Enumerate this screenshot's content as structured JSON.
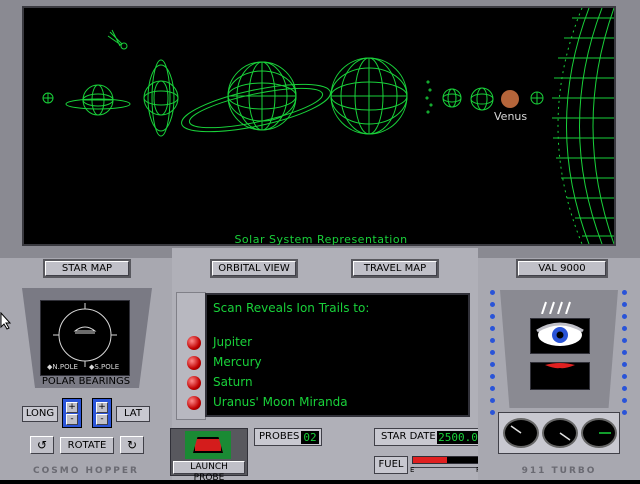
{
  "viewport": {
    "caption": "Solar System Representation",
    "venus_label": "Venus"
  },
  "nav": {
    "star_map": "STAR MAP",
    "orbital_view": "ORBITAL VIEW",
    "travel_map": "TRAVEL MAP",
    "val_9000": "VAL 9000"
  },
  "left_panel": {
    "polar_bearings": "POLAR BEARINGS",
    "n_pole": "N.POLE",
    "s_pole": "S.POLE",
    "long": "LONG",
    "lat": "LAT",
    "rotate": "ROTATE",
    "plus": "+",
    "minus": "-",
    "brand": "COSMO HOPPER"
  },
  "scan": {
    "heading": "Scan Reveals Ion Trails to:",
    "targets": [
      "Jupiter",
      "Mercury",
      "Saturn",
      "Uranus' Moon Miranda"
    ]
  },
  "bottom": {
    "launch_probe": "LAUNCH PROBE",
    "probes_label": "PROBES",
    "probes_value": "02",
    "star_date_label": "STAR DATE",
    "star_date_value": "2500.0",
    "fuel_label": "FUEL",
    "fuel_level": 0.5,
    "fuel_e": "E",
    "fuel_f": "F"
  },
  "right_panel": {
    "brand": "911 TURBO"
  },
  "colors": {
    "wireframe": "#19d13a",
    "panel": "#a8a8b0",
    "venus": "#b5653a"
  }
}
